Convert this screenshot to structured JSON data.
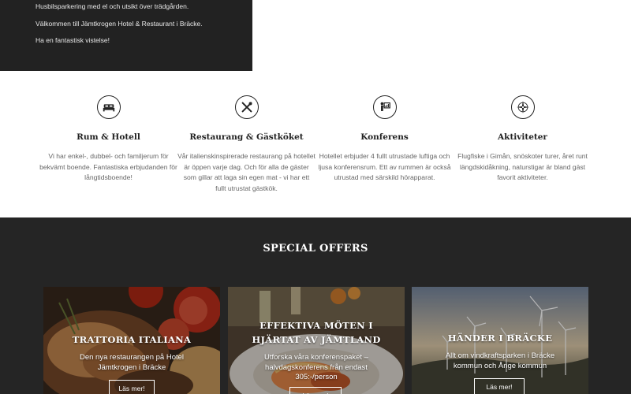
{
  "intro": {
    "line1": "Husbilsparkering med el och utsikt över trädgården.",
    "line2": "Välkommen till Jämtkrogen Hotel & Restaurant i Bräcke.",
    "line3": "Ha en fantastisk vistelse!"
  },
  "features": [
    {
      "icon": "bed-icon",
      "title": "Rum & Hotell",
      "text": "Vi har enkel-, dubbel- och familjerum för bekvämt boende. Fantastiska erbjudanden för långtidsboende!"
    },
    {
      "icon": "cutlery-icon",
      "title": "Restaurang & Gästköket",
      "text": "Vår italienskinspirerade restaurang på hotellet är öppen varje dag. Och för alla de gäster som gillar att laga sin egen mat - vi har ett fullt utrustat gästkök."
    },
    {
      "icon": "presentation-icon",
      "title": "Konferens",
      "text": "Hotellet erbjuder 4 fullt utrustade luftiga och ljusa konferensrum. Ett av rummen är också utrustad med särskild hörapparat."
    },
    {
      "icon": "compass-icon",
      "title": "Aktiviteter",
      "text": "Flugfiske i Gimån, snöskoter turer, året runt längdskidåkning, naturstigar är bland gäst favorit aktiviteter."
    }
  ],
  "offers": {
    "heading": "SPECIAL OFFERS",
    "cards": [
      {
        "title": "TRATTORIA ITALIANA",
        "text": "Den nya restaurangen på Hotel Jämtkrogen i Bräcke",
        "button": "Läs mer!"
      },
      {
        "title": "EFFEKTIVA MÖTEN I HJÄRTAT AV JÄMTLAND",
        "text": "Utforska våra konferenspaket – halvdagskonferens från endast 305:-/person",
        "button": "Läs mer!"
      },
      {
        "title": "HÄNDER I BRÄCKE",
        "text": "Allt om vindkraftsparken i Bräcke kommun och Ånge kommun",
        "button": "Läs mer!"
      }
    ]
  },
  "colors": {
    "dark": "#222222",
    "section_dark": "#252525",
    "text_muted": "#666666"
  }
}
